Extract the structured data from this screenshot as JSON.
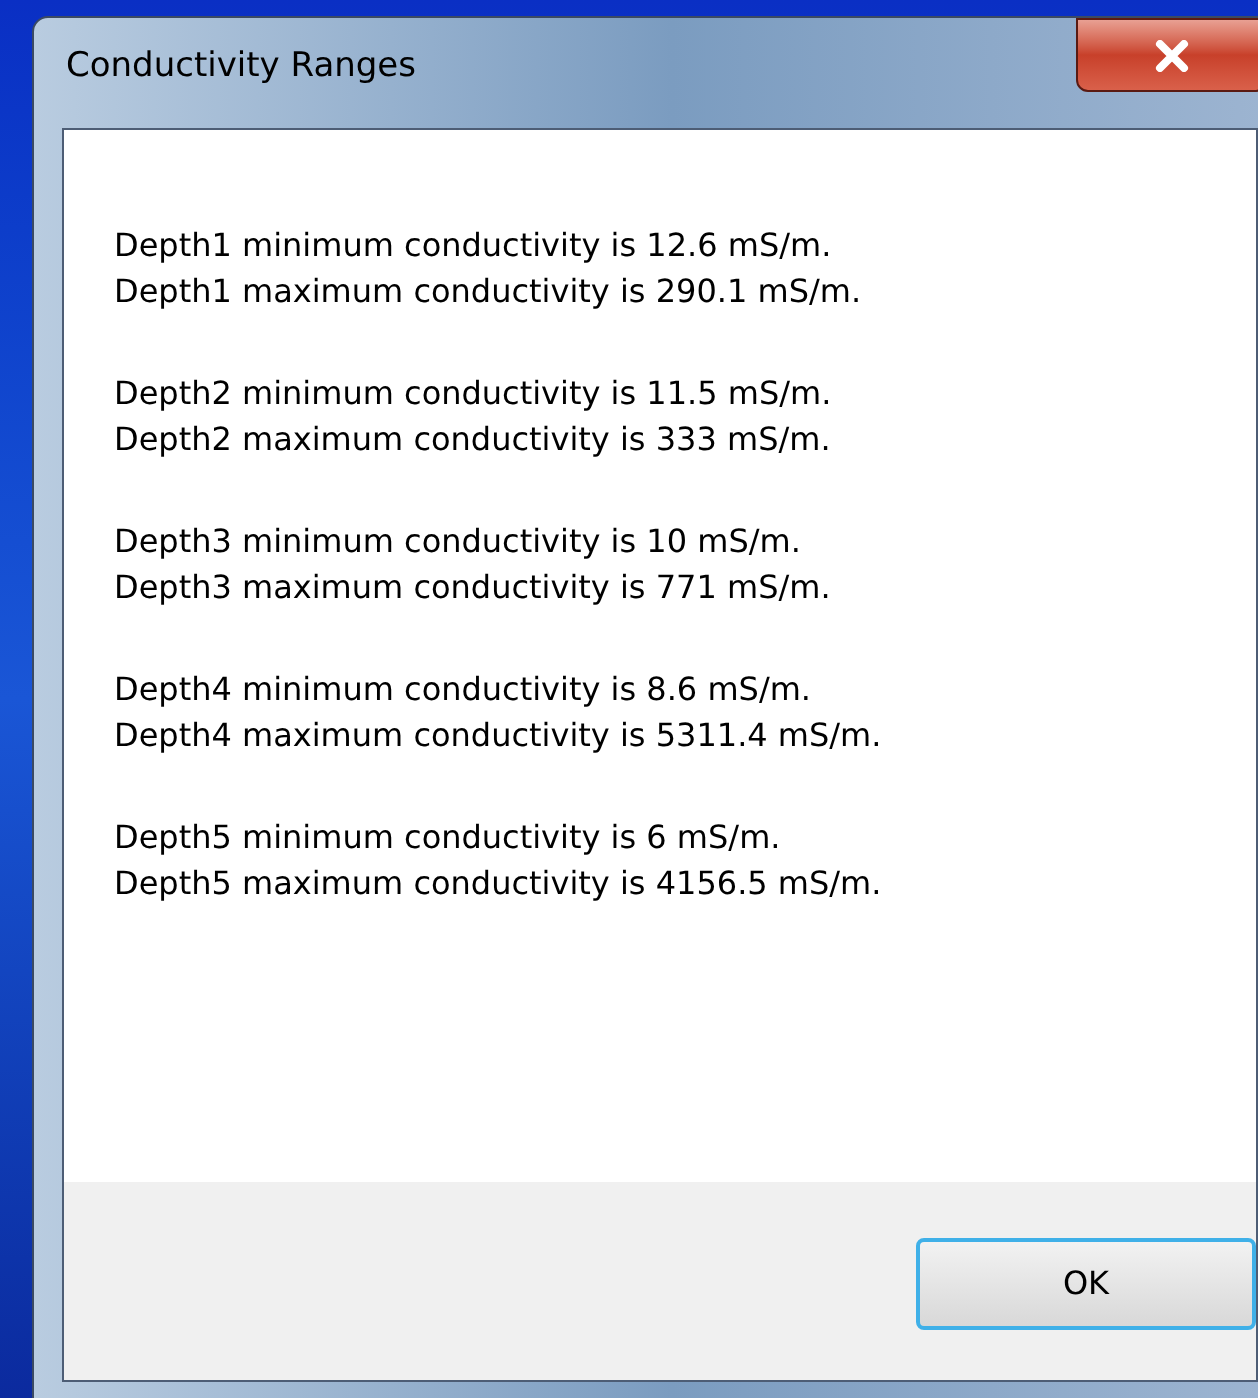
{
  "window": {
    "title": "Conductivity Ranges"
  },
  "message_groups": [
    {
      "lines": [
        "Depth1 minimum conductivity is 12.6 mS/m.",
        "Depth1 maximum conductivity is 290.1 mS/m."
      ]
    },
    {
      "lines": [
        "Depth2 minimum conductivity is 11.5 mS/m.",
        "Depth2 maximum conductivity is 333 mS/m."
      ]
    },
    {
      "lines": [
        "Depth3 minimum conductivity is 10 mS/m.",
        "Depth3 maximum conductivity is 771 mS/m."
      ]
    },
    {
      "lines": [
        "Depth4 minimum conductivity is 8.6 mS/m.",
        "Depth4 maximum conductivity is 5311.4 mS/m."
      ]
    },
    {
      "lines": [
        "Depth5 minimum conductivity is 6 mS/m.",
        "Depth5 maximum conductivity is 4156.5 mS/m."
      ]
    }
  ],
  "buttons": [
    {
      "label": "OK",
      "selected": true
    }
  ]
}
